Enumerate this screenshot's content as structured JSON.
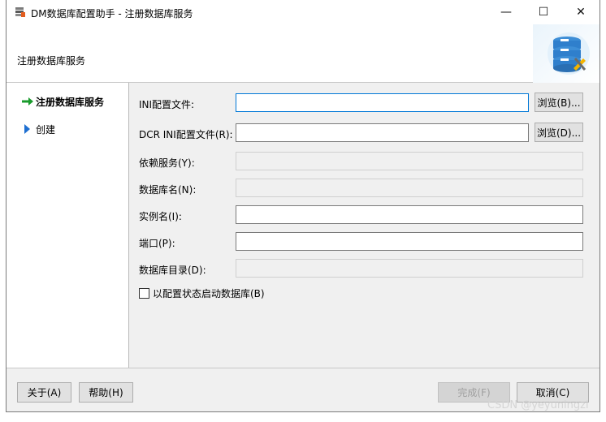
{
  "window": {
    "title": "DM数据库配置助手 - 注册数据库服务",
    "controls": {
      "minimize": "—",
      "maximize": "☐",
      "close": "✕"
    }
  },
  "banner": {
    "title": "注册数据库服务"
  },
  "nav": {
    "items": [
      {
        "label": "注册数据库服务",
        "state": "active"
      },
      {
        "label": "创建",
        "state": "pending"
      }
    ]
  },
  "form": {
    "ini_file": {
      "label": "INI配置文件:",
      "value": "",
      "browse": "浏览(B)..."
    },
    "dcr_ini_file": {
      "label": "DCR INI配置文件(R):",
      "value": "",
      "browse": "浏览(D)..."
    },
    "depends": {
      "label": "依赖服务(Y):",
      "value": ""
    },
    "db_name": {
      "label": "数据库名(N):",
      "value": ""
    },
    "instance_name": {
      "label": "实例名(I):",
      "value": ""
    },
    "port": {
      "label": "端口(P):",
      "value": ""
    },
    "db_dir": {
      "label": "数据库目录(D):",
      "value": ""
    },
    "start_with_config": {
      "label": "以配置状态启动数据库(B)",
      "checked": false
    }
  },
  "footer": {
    "about": "关于(A)",
    "help": "帮助(H)",
    "finish": "完成(F)",
    "cancel": "取消(C)"
  },
  "watermark": "CSDN @yeyuningzi",
  "colors": {
    "arrow_active": "#1a9b2c",
    "arrow_pending": "#1e6fd1",
    "focus": "#0078d7"
  }
}
